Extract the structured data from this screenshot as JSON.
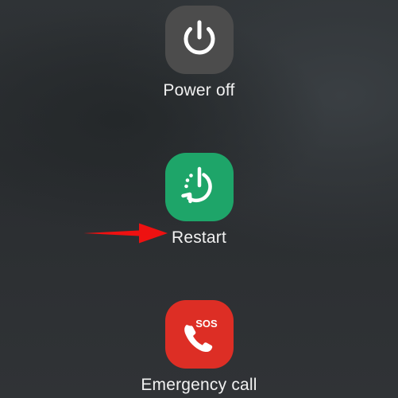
{
  "power_menu": {
    "options": [
      {
        "label": "Power off",
        "icon": "power-icon",
        "color": "#4c4c4c"
      },
      {
        "label": "Restart",
        "icon": "restart-icon",
        "color": "#1ea569"
      },
      {
        "label": "Emergency call",
        "icon": "sos-phone-icon",
        "color": "#dd2e25",
        "badge": "SOS"
      }
    ]
  },
  "annotation": {
    "icon": "red-arrow-icon",
    "color": "#ee1111"
  }
}
